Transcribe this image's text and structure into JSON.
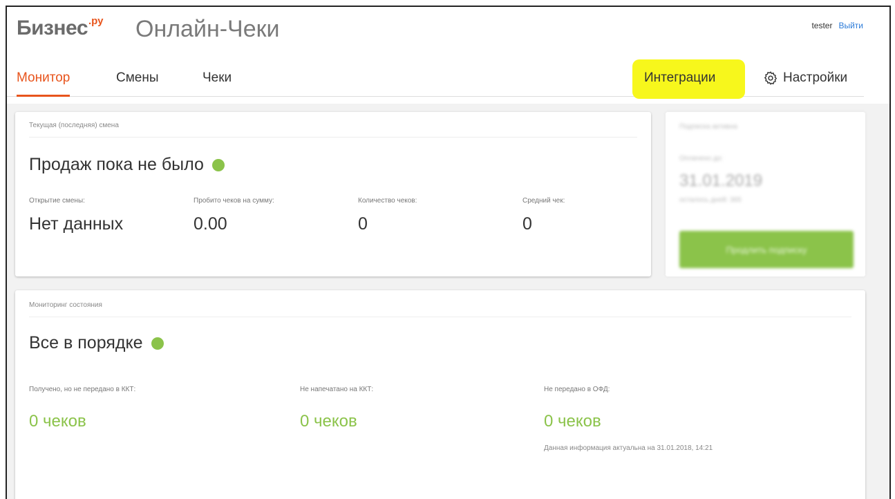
{
  "header": {
    "logo_main": "Бизнес",
    "logo_sup": ".ру",
    "app_title": "Онлайн-Чеки",
    "user": "tester",
    "logout": "Выйти"
  },
  "nav": {
    "monitor": "Монитор",
    "shifts": "Смены",
    "checks": "Чеки",
    "integrations": "Интеграции",
    "settings": "Настройки"
  },
  "current_shift": {
    "title": "Текущая (последняя) смена",
    "status": "Продаж пока не было",
    "stats": [
      {
        "label": "Открытие смены:",
        "value": "Нет данных"
      },
      {
        "label": "Пробито чеков на сумму:",
        "value": "0.00"
      },
      {
        "label": "Количество чеков:",
        "value": "0"
      },
      {
        "label": "Средний чек:",
        "value": "0"
      }
    ]
  },
  "subscription": {
    "title": "Подписка активна",
    "label": "Оплачено до:",
    "date": "31.01.2019",
    "days_left": "осталось дней: 365",
    "button": "Продлить подписку"
  },
  "monitoring": {
    "title": "Мониторинг состояния",
    "status": "Все в порядке",
    "items": [
      {
        "label": "Получено, но не передано в ККТ:",
        "value": "0 чеков"
      },
      {
        "label": "Не напечатано на ККТ:",
        "value": "0 чеков"
      },
      {
        "label": "Не передано в ОФД:",
        "value": "0 чеков"
      }
    ],
    "note": "Данная информация актуальна на 31.01.2018, 14:21"
  },
  "colors": {
    "accent": "#e8541c",
    "ok_green": "#8bc34a",
    "highlight": "#f7f71c",
    "link": "#2a7ad8"
  }
}
